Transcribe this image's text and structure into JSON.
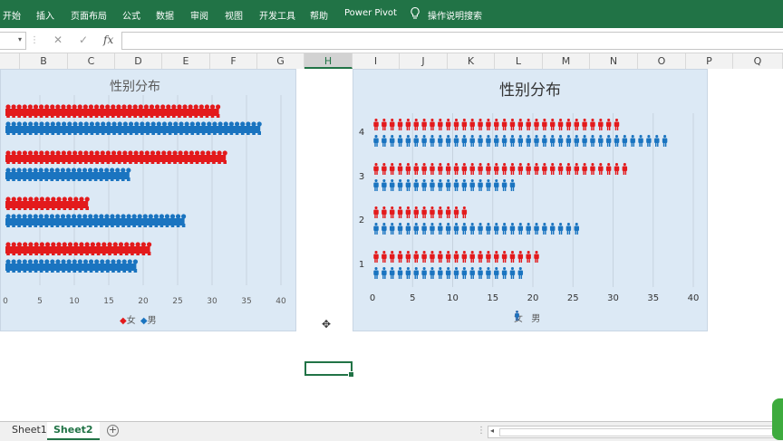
{
  "ribbon": {
    "tabs": [
      "开始",
      "插入",
      "页面布局",
      "公式",
      "数据",
      "审阅",
      "视图",
      "开发工具",
      "帮助",
      "Power Pivot"
    ],
    "tell_me": "操作说明搜索"
  },
  "formula_bar": {
    "cancel": "✕",
    "enter": "✓",
    "fx": "fx",
    "value": ""
  },
  "columns": [
    "B",
    "C",
    "D",
    "E",
    "F",
    "G",
    "H",
    "I",
    "J",
    "K",
    "L",
    "M",
    "N",
    "O",
    "P",
    "Q"
  ],
  "selected_column": "H",
  "sheets": [
    "Sheet1",
    "Sheet2"
  ],
  "active_sheet": "Sheet2",
  "colors": {
    "female": "#e31a1c",
    "male": "#1a74c0",
    "excel_green": "#217346"
  },
  "chart_data": [
    {
      "type": "bar",
      "title": "性别分布",
      "orientation": "horizontal",
      "categories": [],
      "series": [
        {
          "name": "女",
          "values": [
            21,
            12,
            32,
            31
          ]
        },
        {
          "name": "男",
          "values": [
            19,
            26,
            18,
            37
          ]
        }
      ],
      "x_ticks": [
        "0",
        "5",
        "10",
        "15",
        "20",
        "25",
        "30",
        "35",
        "40"
      ],
      "xlim": [
        0,
        40
      ],
      "legend": "bottom",
      "grid": true
    },
    {
      "type": "bar",
      "title": "性别分布",
      "orientation": "horizontal",
      "categories": [
        "1",
        "2",
        "3",
        "4"
      ],
      "series": [
        {
          "name": "女",
          "values": [
            21,
            12,
            32,
            31
          ]
        },
        {
          "name": "男",
          "values": [
            19,
            26,
            18,
            37
          ]
        }
      ],
      "x_ticks": [
        "0",
        "5",
        "10",
        "15",
        "20",
        "25",
        "30",
        "35",
        "40"
      ],
      "xlim": [
        0,
        40
      ],
      "legend": "bottom",
      "grid": true
    }
  ]
}
